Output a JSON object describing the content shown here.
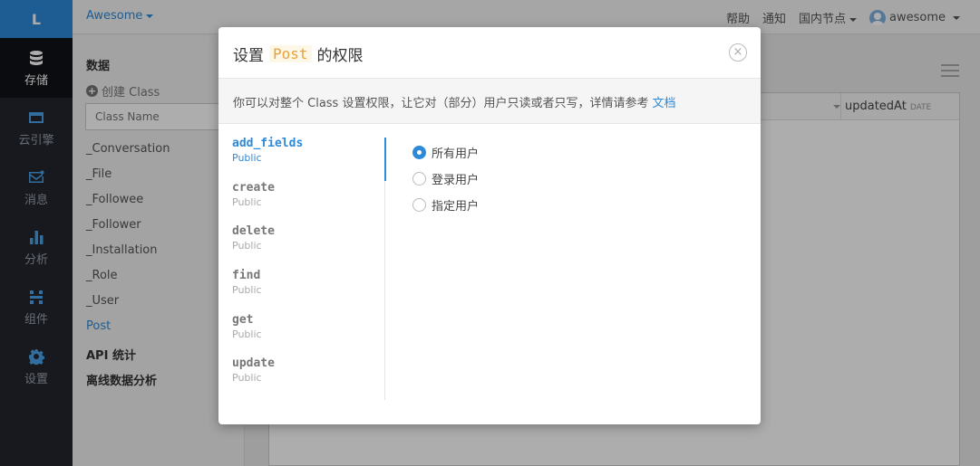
{
  "logo": "L",
  "nav": [
    {
      "label": "存储",
      "icon": "database-icon",
      "active": true
    },
    {
      "label": "云引擎",
      "icon": "cloud-engine-icon",
      "active": false
    },
    {
      "label": "消息",
      "icon": "message-icon",
      "active": false
    },
    {
      "label": "分析",
      "icon": "bar-chart-icon",
      "active": false
    },
    {
      "label": "组件",
      "icon": "component-icon",
      "active": false
    },
    {
      "label": "设置",
      "icon": "gear-icon",
      "active": false
    }
  ],
  "topbar": {
    "app_name": "Awesome",
    "help": "帮助",
    "notify": "通知",
    "region": "国内节点",
    "user": "awesome"
  },
  "sidebar": {
    "data_heading": "数据",
    "create_class": "创建 Class",
    "class_placeholder": "Class Name",
    "classes": [
      "_Conversation",
      "_File",
      "_Followee",
      "_Follower",
      "_Installation",
      "_Role",
      "_User",
      "Post"
    ],
    "active_class": "Post",
    "api_stats": "API 统计",
    "offline_analysis": "离线数据分析"
  },
  "table": {
    "updated_col": "updatedAt",
    "updated_type": "DATE"
  },
  "modal": {
    "title_prefix": "设置",
    "title_class": "Post",
    "title_suffix": "的权限",
    "description": "你可以对整个 Class 设置权限，让它对（部分）用户只读或者只写，详情请参考",
    "doc_link": "文档",
    "permissions": [
      {
        "name": "add_fields",
        "scope": "Public",
        "active": true
      },
      {
        "name": "create",
        "scope": "Public",
        "active": false
      },
      {
        "name": "delete",
        "scope": "Public",
        "active": false
      },
      {
        "name": "find",
        "scope": "Public",
        "active": false
      },
      {
        "name": "get",
        "scope": "Public",
        "active": false
      },
      {
        "name": "update",
        "scope": "Public",
        "active": false
      }
    ],
    "options": [
      {
        "label": "所有用户",
        "checked": true
      },
      {
        "label": "登录用户",
        "checked": false
      },
      {
        "label": "指定用户",
        "checked": false
      }
    ]
  },
  "colors": {
    "accent": "#2d8ad9",
    "sidebar_dark": "#22262e",
    "class_tag": "#e8a23a"
  }
}
